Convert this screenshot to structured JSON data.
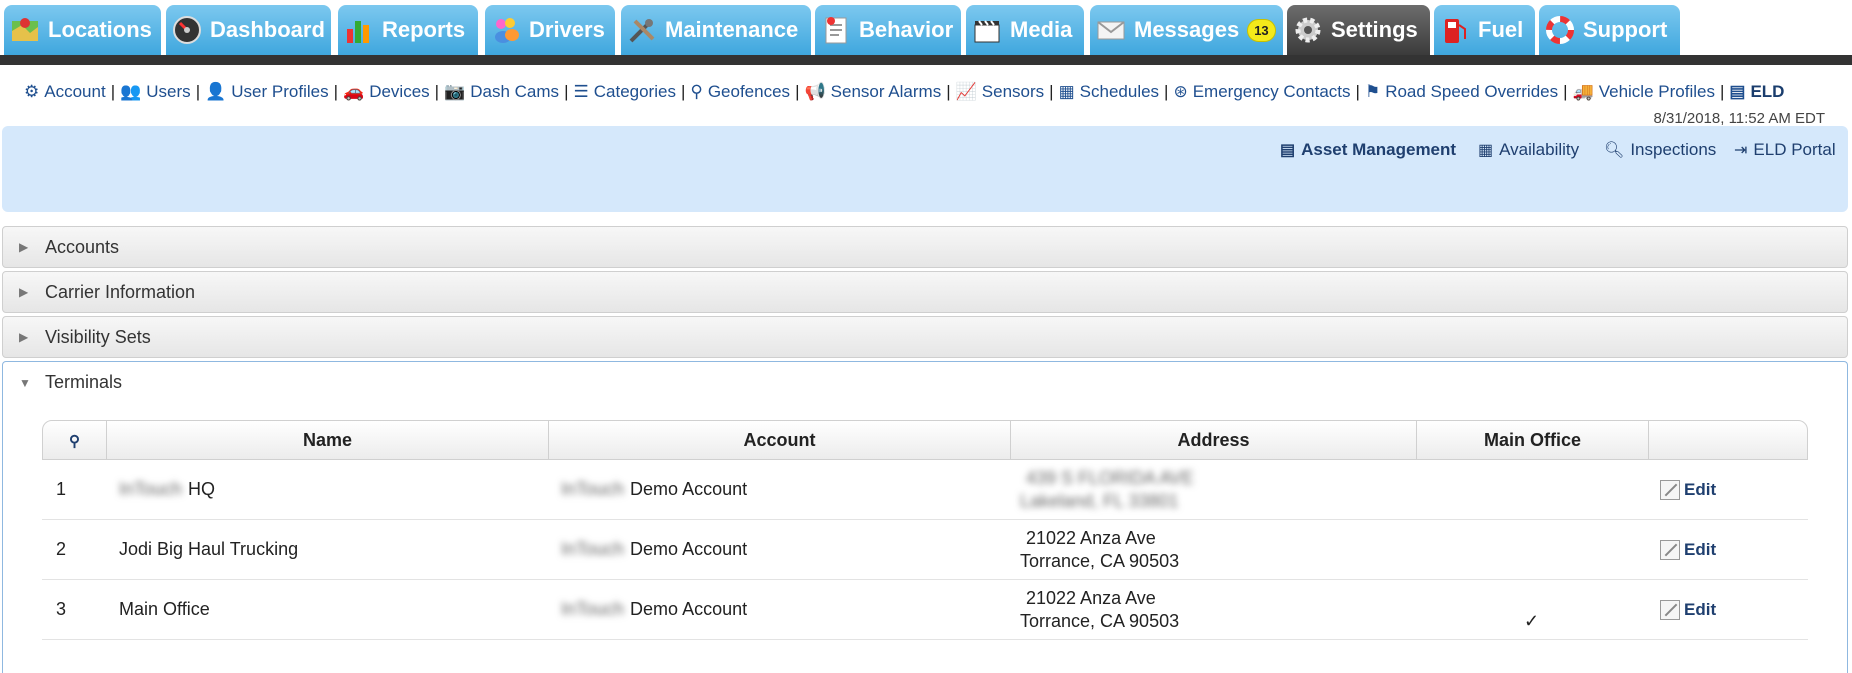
{
  "tabs": [
    {
      "label": "Locations",
      "icon": "locations-icon"
    },
    {
      "label": "Dashboard",
      "icon": "dashboard-icon"
    },
    {
      "label": "Reports",
      "icon": "reports-icon"
    },
    {
      "label": "Drivers",
      "icon": "drivers-icon"
    },
    {
      "label": "Maintenance",
      "icon": "maintenance-icon"
    },
    {
      "label": "Behavior",
      "icon": "behavior-icon"
    },
    {
      "label": "Media",
      "icon": "media-icon"
    },
    {
      "label": "Messages",
      "icon": "messages-icon",
      "badge": "13"
    },
    {
      "label": "Settings",
      "icon": "settings-icon",
      "active": true
    },
    {
      "label": "Fuel",
      "icon": "fuel-icon"
    },
    {
      "label": "Support",
      "icon": "support-icon"
    }
  ],
  "subnav": [
    {
      "label": "Account",
      "icon": "gear-icon"
    },
    {
      "label": "Users",
      "icon": "users-icon"
    },
    {
      "label": "User Profiles",
      "icon": "user-profiles-icon"
    },
    {
      "label": "Devices",
      "icon": "car-icon"
    },
    {
      "label": "Dash Cams",
      "icon": "camera-icon"
    },
    {
      "label": "Categories",
      "icon": "list-icon"
    },
    {
      "label": "Geofences",
      "icon": "map-marker-icon"
    },
    {
      "label": "Sensor Alarms",
      "icon": "bullhorn-icon"
    },
    {
      "label": "Sensors",
      "icon": "line-chart-icon"
    },
    {
      "label": "Schedules",
      "icon": "calendar-icon"
    },
    {
      "label": "Emergency Contacts",
      "icon": "life-ring-icon"
    },
    {
      "label": "Road Speed Overrides",
      "icon": "flag-icon"
    },
    {
      "label": "Vehicle Profiles",
      "icon": "truck-icon"
    },
    {
      "label": "ELD",
      "icon": "eld-list-icon",
      "active": true
    }
  ],
  "timestamp": "8/31/2018, 11:52 AM EDT",
  "panel_links": [
    {
      "label": "Asset Management",
      "icon": "list-alt-icon"
    },
    {
      "label": "Availability",
      "icon": "calendar-icon"
    },
    {
      "label": "Inspections",
      "icon": "search-icon"
    },
    {
      "label": "ELD Portal",
      "icon": "sign-in-icon"
    }
  ],
  "sections": [
    {
      "label": "Accounts"
    },
    {
      "label": "Carrier Information"
    },
    {
      "label": "Visibility Sets"
    },
    {
      "label": "Terminals",
      "open": true
    }
  ],
  "table": {
    "pin_icon": "map-marker-icon",
    "headers": [
      "Name",
      "Account",
      "Address",
      "Main Office",
      ""
    ],
    "rows": [
      {
        "num": "1",
        "name_blur": "InTouch",
        "name": "HQ",
        "account_blur": "InTouch",
        "account": "Demo Account",
        "addr1": "439 S FLORIDA AVE",
        "addr2": "Lakeland, FL 33801",
        "addr_blurred": true,
        "main": "",
        "edit": "Edit"
      },
      {
        "num": "2",
        "name_blur": "",
        "name": "Jodi Big Haul Trucking",
        "account_blur": "InTouch",
        "account": "Demo Account",
        "addr1": "21022 Anza Ave",
        "addr2": "Torrance, CA 90503",
        "addr_blurred": false,
        "main": "",
        "edit": "Edit"
      },
      {
        "num": "3",
        "name_blur": "",
        "name": "Main Office",
        "account_blur": "InTouch",
        "account": "Demo Account",
        "addr1": "21022 Anza Ave",
        "addr2": "Torrance, CA 90503",
        "addr_blurred": false,
        "main": "✓",
        "edit": "Edit"
      }
    ]
  }
}
